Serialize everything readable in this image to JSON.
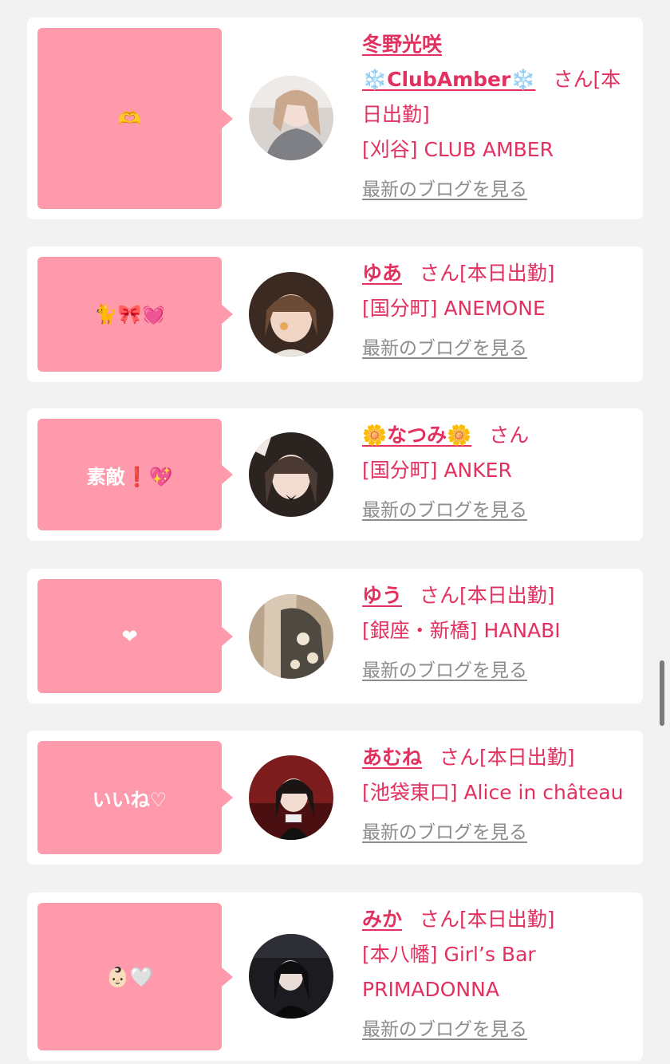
{
  "colors": {
    "accent": "#e2305f",
    "bubble": "#fe9aab",
    "link_gray": "#8c8c8c",
    "background": "#f2f2f2"
  },
  "entries": [
    {
      "comment": "🫶",
      "name": "冬野光咲\n❄️ClubAmber❄️",
      "suffix": "さん[本日出勤]",
      "shop": "[刈谷] CLUB AMBER",
      "blog_link": "最新のブログを見る"
    },
    {
      "comment": "🐈🎀💓",
      "name": "ゆあ",
      "suffix": "さん[本日出勤]",
      "shop": "[国分町] ANEMONE",
      "blog_link": "最新のブログを見る"
    },
    {
      "comment": "素敵❗️💖",
      "name": "🌼なつみ🌼",
      "suffix": "さん",
      "shop": "[国分町] ANKER",
      "blog_link": "最新のブログを見る"
    },
    {
      "comment": "❤",
      "name": "ゆう",
      "suffix": "さん[本日出勤]",
      "shop": "[銀座・新橋] HANABI",
      "blog_link": "最新のブログを見る"
    },
    {
      "comment": "いいね♡",
      "name": "あむね",
      "suffix": "さん[本日出勤]",
      "shop": "[池袋東口] Alice in château",
      "blog_link": "最新のブログを見る"
    },
    {
      "comment": "👶🏻🤍",
      "name": "みか",
      "suffix": "さん[本日出勤]",
      "shop": "[本八幡] Girl’s Bar PRIMADONNA",
      "blog_link": "最新のブログを見る"
    }
  ]
}
